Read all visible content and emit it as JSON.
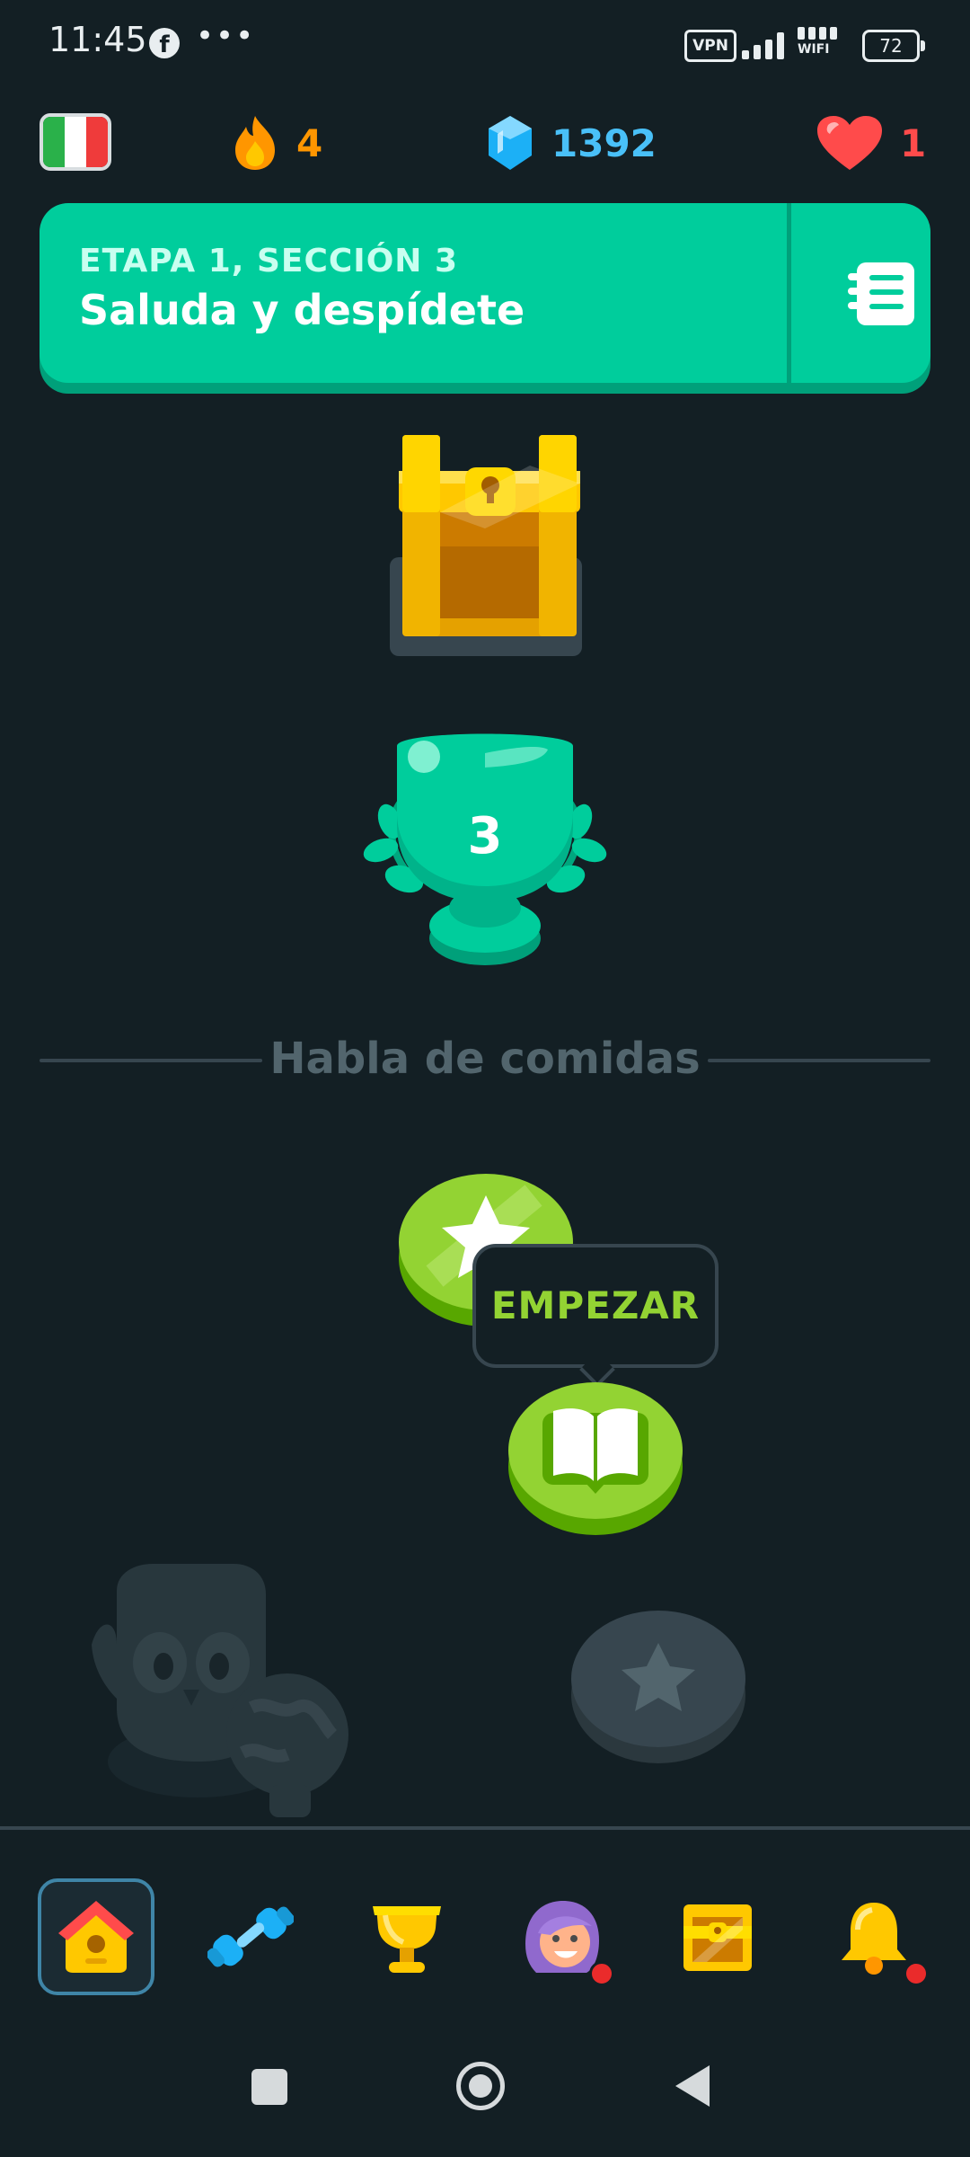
{
  "status_bar": {
    "time": "11:45",
    "vpn": "VPN",
    "wifi": "WIFI",
    "battery": "72"
  },
  "top_stats": {
    "course_flag": "italian-flag",
    "streak": "4",
    "gems": "1392",
    "hearts": "1"
  },
  "unit_banner": {
    "stage": "ETAPA 1, SECCIÓN 3",
    "title": "Saluda y despídete"
  },
  "path": {
    "trophy_level": "3",
    "section_title": "Habla de comidas",
    "start_tooltip": "EMPEZAR"
  },
  "bottom_nav": {
    "items": [
      "home-icon",
      "practice-icon",
      "leaderboard-icon",
      "profile-icon",
      "shop-chest-icon",
      "notifications-icon"
    ]
  },
  "colors": {
    "background": "#131f24",
    "banner": "#00cd9c",
    "streak": "#ff9600",
    "gems": "#49c0f8",
    "hearts": "#ff4b4b",
    "lesson_green": "#93d333"
  }
}
